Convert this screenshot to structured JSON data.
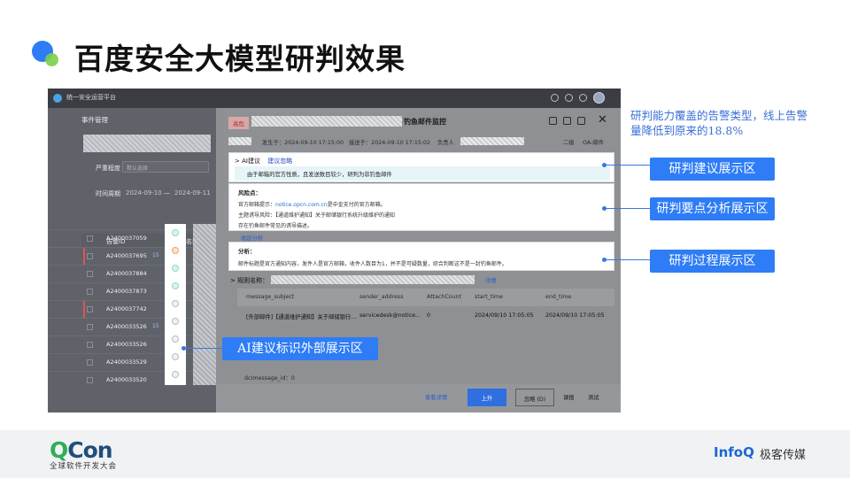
{
  "slide": {
    "title": "百度安全大模型研判效果",
    "side_note": "研判能力覆盖的告警类型，线上告警量降低到原来的18.8%"
  },
  "callouts": {
    "suggestion": "研判建议展示区",
    "keypoints": "研判要点分析展示区",
    "process": "研判过程展示区",
    "ai_mark": "AI建议标识外部展示区"
  },
  "app": {
    "title": "统一安全运营平台",
    "left_panel": {
      "heading": "事件管理",
      "severity_label": "严重程度",
      "severity_placeholder": "默认选择",
      "time_label": "时间周期",
      "date_from": "2024-09-10",
      "date_sep": "—",
      "date_to": "2024-09-11",
      "col_alarm_id": "告警ID",
      "col_alarm_name": "告警名称",
      "rows": [
        {
          "id": "A2400037059",
          "tag": "",
          "status": "green",
          "flag": false
        },
        {
          "id": "A2400037695",
          "tag": "15",
          "status": "orange",
          "flag": true
        },
        {
          "id": "A2400037884",
          "tag": "",
          "status": "green",
          "flag": false
        },
        {
          "id": "A2400037873",
          "tag": "",
          "status": "green",
          "flag": false
        },
        {
          "id": "A2400037742",
          "tag": "",
          "status": "grey",
          "flag": true
        },
        {
          "id": "A2400033526",
          "tag": "15",
          "status": "grey",
          "flag": false
        },
        {
          "id": "A2400033526",
          "tag": "",
          "status": "grey",
          "flag": false
        },
        {
          "id": "A2400033529",
          "tag": "",
          "status": "grey",
          "flag": false
        },
        {
          "id": "A2400033520",
          "tag": "",
          "status": "grey",
          "flag": false
        }
      ]
    },
    "detail": {
      "badge": "高危",
      "title_suffix": "钓鱼邮件监控",
      "occurred_at": "发生于：2024-09-10 17:15:00",
      "received_at": "接送于：2024-09-10 17:15:02",
      "owner_label": "负责人",
      "level": "二级",
      "category": "OA-邮件",
      "ai_label": "AI建议",
      "ai_action": "建议忽略",
      "ai_conclusion": "由于邮箱的官方性质，且发送数目较少，研判为非钓鱼邮件",
      "risk_heading": "风险点：",
      "risk_line1_prefix": "官方邮箱提示：",
      "risk_line1_link": "notice.opcn.com.cn",
      "risk_line1_suffix": "是中金支付的官方邮箱。",
      "risk_line2": "主题诱导风险：【通道维护通知】关于邮储银行系统升级维护的通知",
      "risk_line3": "存在钓鱼邮件常见的诱导描述。",
      "fold_link": "收起分析",
      "analysis_heading": "分析：",
      "analysis_text": "邮件标题是官方通知内容，发件人是官方邮箱，收件人数目为1，并不是可疑数量，综合判断这不是一封钓鱼邮件。",
      "rule_label": "规则名称：",
      "rule_link": "详情",
      "table_headers": [
        "message_subject",
        "sender_address",
        "AttachCount",
        "start_time",
        "end_time"
      ],
      "table_row": [
        "[外部邮件]【通道维护通知】关于邮储银行...",
        "servicedesk@notice...",
        "0",
        "2024/09/10 17:05:05",
        "2024/09/10 17:05:05"
      ],
      "dm_text": "dcImessage_id：",
      "dm_value": "0",
      "btn_details": "查看详情",
      "btn_upgrade": "上升",
      "btn_ignore": "忽略",
      "btn_ignore_key": "(D)",
      "btn_report": "课报",
      "btn_test": "测试"
    }
  },
  "footer": {
    "qcon_q": "Q",
    "qcon_rest": "Con",
    "qcon_sub": "全球软件开发大会",
    "infoq": "InfoQ",
    "geek": "极客传媒"
  }
}
